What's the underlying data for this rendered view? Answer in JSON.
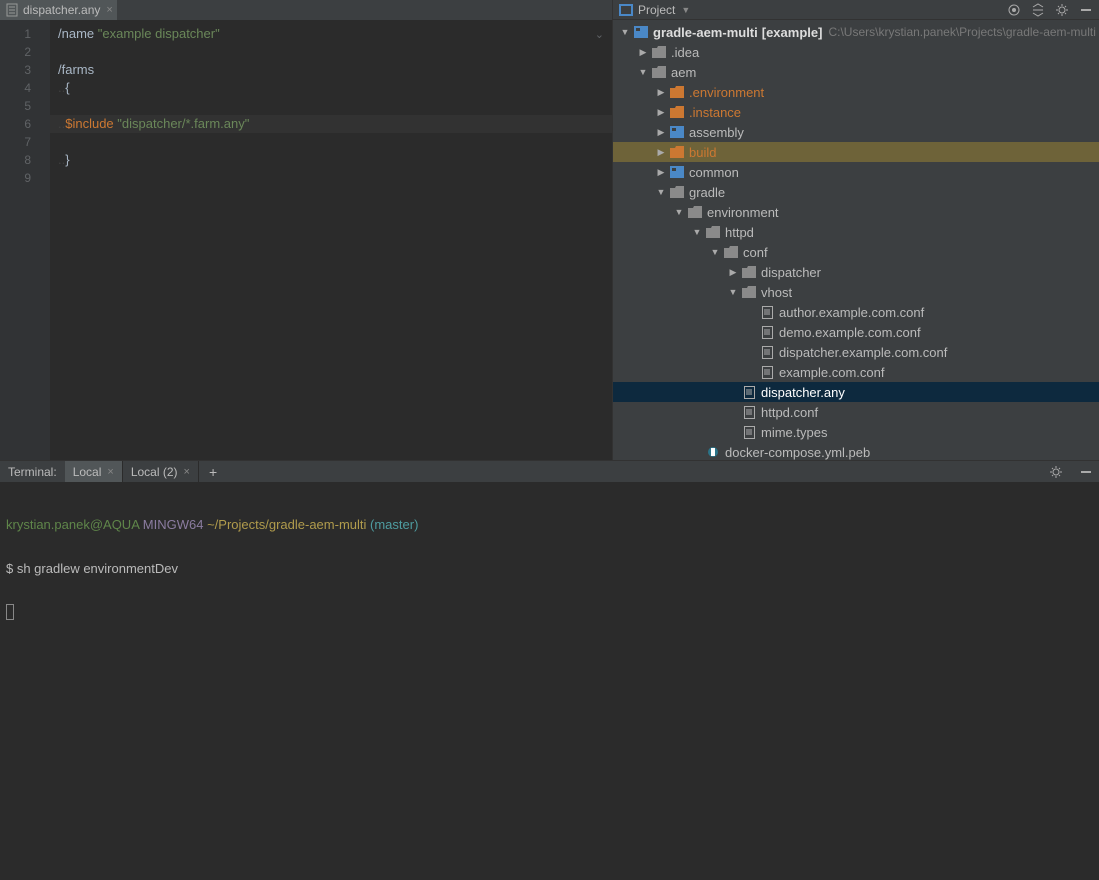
{
  "editor": {
    "tab": {
      "filename": "dispatcher.any"
    },
    "lines": [
      {
        "n": 1,
        "segs": [
          {
            "t": "/name ",
            "c": ""
          },
          {
            "t": "\"example dispatcher\"",
            "c": "str"
          }
        ]
      },
      {
        "n": 2,
        "segs": []
      },
      {
        "n": 3,
        "segs": [
          {
            "t": "/farms",
            "c": ""
          }
        ]
      },
      {
        "n": 4,
        "segs": [
          {
            "t": "..",
            "c": "dots"
          },
          {
            "t": "{",
            "c": ""
          }
        ]
      },
      {
        "n": 5,
        "segs": []
      },
      {
        "n": 6,
        "hl": true,
        "segs": [
          {
            "t": "..",
            "c": "dots"
          },
          {
            "t": "$include",
            "c": "kw"
          },
          {
            "t": " ",
            "c": ""
          },
          {
            "t": "\"dispatcher/*.farm.any\"",
            "c": "str"
          }
        ]
      },
      {
        "n": 7,
        "segs": []
      },
      {
        "n": 8,
        "segs": [
          {
            "t": "..",
            "c": "dots"
          },
          {
            "t": "}",
            "c": ""
          }
        ]
      },
      {
        "n": 9,
        "segs": []
      }
    ]
  },
  "project": {
    "title": "Project",
    "tree": [
      {
        "indent": 0,
        "twist": "expanded",
        "icon": "module",
        "label": "gradle-aem-multi",
        "suffix": "[example]",
        "path": "C:\\Users\\krystian.panek\\Projects\\gradle-aem-multi",
        "bold": true
      },
      {
        "indent": 1,
        "twist": "collapsed",
        "icon": "folder",
        "label": ".idea"
      },
      {
        "indent": 1,
        "twist": "expanded",
        "icon": "folder",
        "label": "aem"
      },
      {
        "indent": 2,
        "twist": "collapsed",
        "icon": "ofolder",
        "label": ".environment",
        "orange": true
      },
      {
        "indent": 2,
        "twist": "collapsed",
        "icon": "ofolder",
        "label": ".instance",
        "orange": true
      },
      {
        "indent": 2,
        "twist": "collapsed",
        "icon": "module",
        "label": "assembly"
      },
      {
        "indent": 2,
        "twist": "collapsed",
        "icon": "ofolder",
        "label": "build",
        "orange": true,
        "buildhl": true
      },
      {
        "indent": 2,
        "twist": "collapsed",
        "icon": "module",
        "label": "common"
      },
      {
        "indent": 2,
        "twist": "expanded",
        "icon": "folder",
        "label": "gradle"
      },
      {
        "indent": 3,
        "twist": "expanded",
        "icon": "folder",
        "label": "environment"
      },
      {
        "indent": 4,
        "twist": "expanded",
        "icon": "folder",
        "label": "httpd"
      },
      {
        "indent": 5,
        "twist": "expanded",
        "icon": "folder",
        "label": "conf"
      },
      {
        "indent": 6,
        "twist": "collapsed",
        "icon": "folder",
        "label": "dispatcher"
      },
      {
        "indent": 6,
        "twist": "expanded",
        "icon": "folder",
        "label": "vhost"
      },
      {
        "indent": 7,
        "twist": "none",
        "icon": "file",
        "label": "author.example.com.conf"
      },
      {
        "indent": 7,
        "twist": "none",
        "icon": "file",
        "label": "demo.example.com.conf"
      },
      {
        "indent": 7,
        "twist": "none",
        "icon": "file",
        "label": "dispatcher.example.com.conf"
      },
      {
        "indent": 7,
        "twist": "none",
        "icon": "file",
        "label": "example.com.conf"
      },
      {
        "indent": 6,
        "twist": "none",
        "icon": "file",
        "label": "dispatcher.any",
        "sel": true
      },
      {
        "indent": 6,
        "twist": "none",
        "icon": "file",
        "label": "httpd.conf"
      },
      {
        "indent": 6,
        "twist": "none",
        "icon": "file",
        "label": "mime.types"
      },
      {
        "indent": 4,
        "twist": "none",
        "icon": "yml",
        "label": "docker-compose.yml.peb"
      }
    ]
  },
  "terminal": {
    "label": "Terminal:",
    "tabs": [
      {
        "label": "Local",
        "active": true,
        "closable": true
      },
      {
        "label": "Local (2)",
        "active": false,
        "closable": true
      }
    ],
    "prompt": {
      "user": "krystian.panek@AQUA",
      "env": "MINGW64",
      "path": "~/Projects/gradle-aem-multi",
      "branch": "(master)"
    },
    "command": "$ sh gradlew environmentDev"
  }
}
